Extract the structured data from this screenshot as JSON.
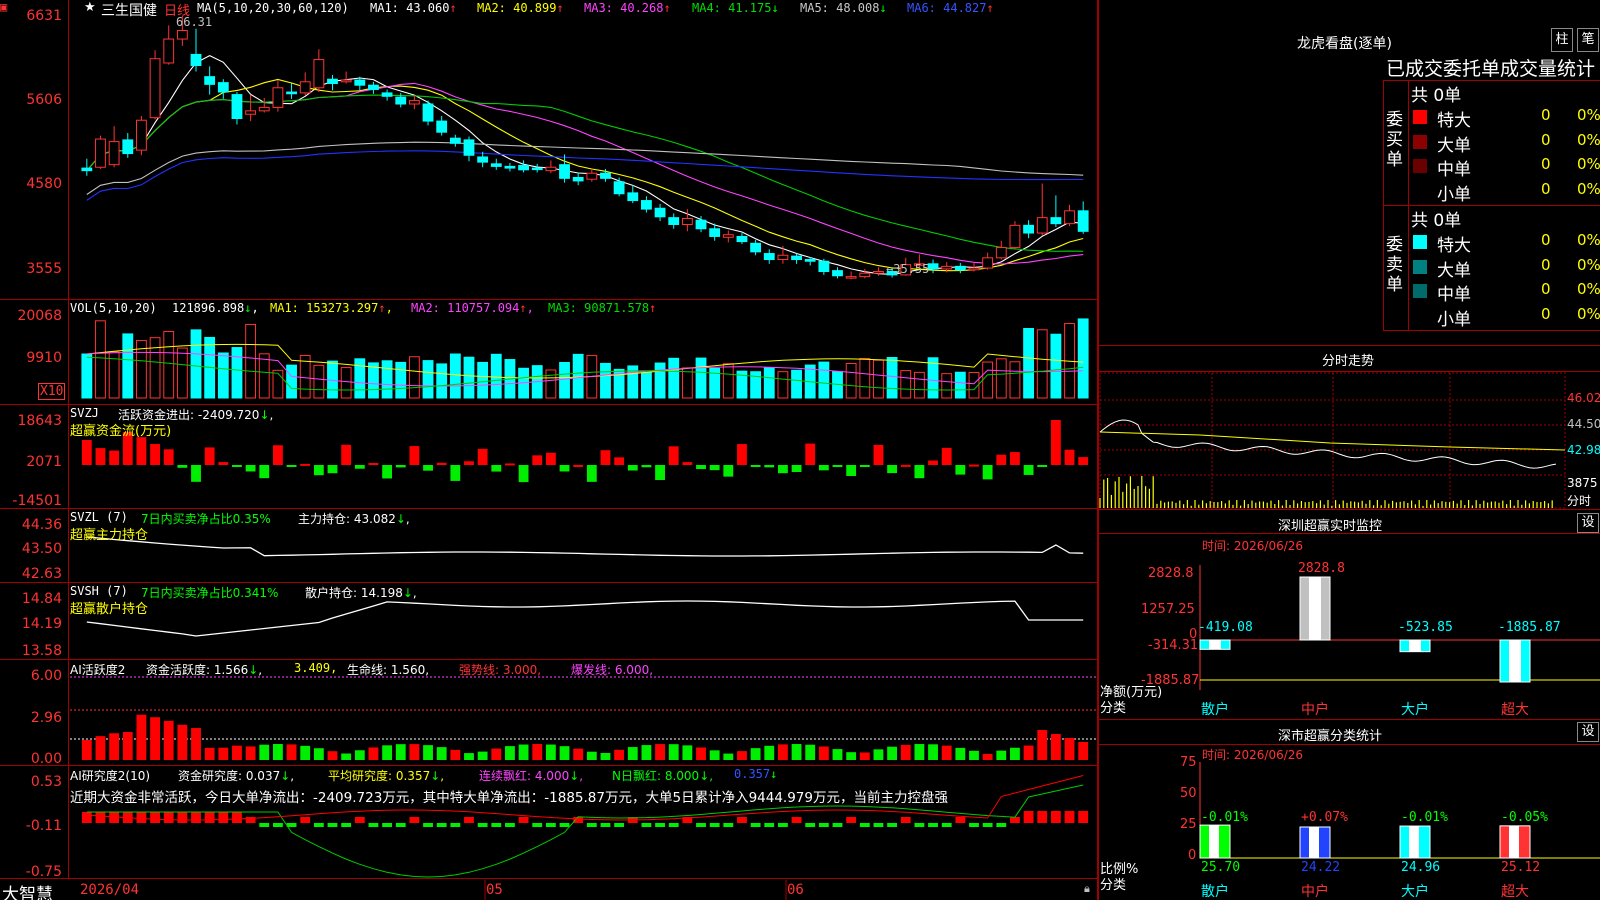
{
  "header": {
    "stock_name": "三生国健",
    "period": "日线",
    "ma_text": "MA(5,10,20,30,60,120)",
    "ma1": "MA1: 43.060",
    "ma2": "MA2: 40.899",
    "ma3": "MA3: 40.268",
    "ma4": "MA4: 41.175",
    "ma5": "MA5: 48.008",
    "ma6": "MA6: 44.827",
    "high_mark": "66.31",
    "low_mark": "35.55"
  },
  "price_axis": [
    "6631",
    "5606",
    "4580",
    "3555"
  ],
  "vol": {
    "title": "VOL(5,10,20)",
    "value": "121896.898",
    "ma1": "MA1: 153273.297",
    "ma2": "MA2: 110757.094",
    "ma3": "MA3: 90871.578",
    "axis": [
      "20068",
      "9910"
    ],
    "unit": "X10"
  },
  "svzj": {
    "title": "SVZJ",
    "desc": "活跃资金进出: -2409.720",
    "sub": "超赢资金流(万元)",
    "axis": [
      "18643",
      "2071",
      "-14501"
    ]
  },
  "svzl": {
    "title": "SVZL (7)",
    "desc": "7日内买卖净占比0.35%",
    "hold": "主力持仓: 43.082",
    "sub": "超赢主力持仓",
    "axis": [
      "44.36",
      "43.50",
      "42.63"
    ]
  },
  "svsh": {
    "title": "SVSH (7)",
    "desc": "7日内买卖净占比0.341%",
    "hold": "散户持仓: 14.198",
    "sub": "超赢散户持仓",
    "axis": [
      "14.84",
      "14.19",
      "13.58"
    ]
  },
  "ai1": {
    "title": "AI活跃度2",
    "a": "资金活跃度: 1.566",
    "b": "3.409,",
    "c": "生命线: 1.560,",
    "d": "强势线: 3.000,",
    "e": "爆发线: 6.000,",
    "axis": [
      "6.00",
      "2.96",
      "0.00"
    ]
  },
  "ai2": {
    "title": "AI研究度2(10)",
    "a": "资金研究度: 0.037",
    "b": "平均研究度: 0.357",
    "c": "连续飘红: 4.000",
    "d": "N日飘红: 8.000",
    "e": "0.357",
    "note": "近期大资金非常活跃，今日大单净流出：-2409.723万元，其中特大单净流出：-1885.87万元，大单5日累计净入9444.979万元，当前主力控盘强",
    "axis": [
      "0.53",
      "-0.11",
      "-0.75"
    ]
  },
  "bottom": {
    "brand": "大智慧",
    "d1": "2026/04",
    "d2": "05",
    "d3": "06"
  },
  "right": {
    "lh_title": "龙虎看盘(逐单)",
    "btn1": "柱",
    "btn2": "笔",
    "stat_title": "已成交委托单成交量统计",
    "buy_label": "委买单",
    "sell_label": "委卖单",
    "buy_total": "共 0单",
    "sell_total": "共 0单",
    "buy_rows": [
      {
        "name": "特大",
        "val": "0",
        "pct": "0%",
        "color": "#ff0000"
      },
      {
        "name": "大单",
        "val": "0",
        "pct": "0%",
        "color": "#8b0000"
      },
      {
        "name": "中单",
        "val": "0",
        "pct": "0%",
        "color": "#6b0000"
      },
      {
        "name": "小单",
        "val": "0",
        "pct": "0%",
        "color": ""
      }
    ],
    "sell_rows": [
      {
        "name": "特大",
        "val": "0",
        "pct": "0%",
        "color": "#00ffff"
      },
      {
        "name": "大单",
        "val": "0",
        "pct": "0%",
        "color": "#008080"
      },
      {
        "name": "中单",
        "val": "0",
        "pct": "0%",
        "color": "#006b6b"
      },
      {
        "name": "小单",
        "val": "0",
        "pct": "0%",
        "color": ""
      }
    ],
    "ts_title": "分时走势",
    "ts_axis": [
      "46.02",
      "44.50",
      "42.98",
      "3875"
    ],
    "ts_foot": "分时",
    "sz_title": "深圳超赢实时监控",
    "sz_btn": "设",
    "sz_time": "时间: 2026/06/26",
    "sz_axis": [
      "2828.8",
      "1257.25",
      "0",
      "-314.31",
      "-1885.87"
    ],
    "sz_vals": [
      "-419.08",
      "2828.8",
      "-523.85",
      "-1885.87"
    ],
    "sz_ylab": "净额(万元)",
    "sz_xlab": "分类",
    "cats": [
      "散户",
      "中户",
      "大户",
      "超大"
    ],
    "cls_title": "深市超赢分类统计",
    "cls_btn": "设",
    "cls_time": "时间: 2026/06/26",
    "cls_axis": [
      "75",
      "50",
      "25",
      "0"
    ],
    "cls_pct": [
      "-0.01%",
      "+0.07%",
      "-0.01%",
      "-0.05%"
    ],
    "cls_vals": [
      "25.70",
      "24.22",
      "24.96",
      "25.12"
    ],
    "cls_ylab": "比例%",
    "cls_xlab": "分类"
  },
  "chart_data": {
    "type": "bar",
    "title": "深圳超赢实时监控",
    "categories": [
      "散户",
      "中户",
      "大户",
      "超大"
    ],
    "values": [
      -419.08,
      2828.8,
      -523.85,
      -1885.87
    ],
    "ylabel": "净额(万元)",
    "ylim": [
      -1885.87,
      2828.8
    ],
    "candles": [
      [
        48.5,
        48.2,
        49.6,
        47.6
      ],
      [
        48.6,
        51.9,
        52.3,
        48.4
      ],
      [
        48.9,
        51.6,
        53.4,
        48.6
      ],
      [
        51.8,
        50.2,
        52.6,
        49.7
      ],
      [
        50.6,
        54.1,
        54.6,
        50.0
      ],
      [
        54.4,
        61.3,
        62.3,
        54.2
      ],
      [
        60.8,
        63.6,
        65.2,
        60.6
      ],
      [
        63.6,
        64.6,
        66.3,
        62.8
      ],
      [
        61.8,
        60.5,
        64.8,
        59.8
      ],
      [
        59.2,
        58.3,
        60.4,
        57.1
      ],
      [
        58.5,
        57.4,
        58.9,
        56.6
      ],
      [
        57.1,
        54.3,
        57.4,
        53.6
      ],
      [
        54.8,
        55.2,
        57.1,
        54.0
      ],
      [
        55.2,
        55.6,
        56.7,
        55.0
      ],
      [
        55.6,
        57.9,
        58.8,
        55.1
      ],
      [
        57.4,
        57.2,
        58.4,
        56.6
      ],
      [
        57.3,
        58.6,
        59.7,
        57.0
      ],
      [
        57.9,
        61.2,
        62.4,
        57.4
      ],
      [
        58.9,
        58.4,
        59.4,
        57.6
      ],
      [
        58.6,
        58.8,
        59.8,
        58.4
      ],
      [
        58.8,
        58.2,
        59.2,
        57.6
      ],
      [
        58.2,
        57.7,
        58.6,
        57.2
      ],
      [
        57.3,
        56.9,
        57.7,
        56.4
      ],
      [
        56.8,
        56.0,
        57.3,
        55.6
      ],
      [
        56.0,
        56.4,
        57.0,
        55.4
      ],
      [
        56.0,
        54.0,
        56.4,
        53.5
      ],
      [
        54.0,
        52.7,
        54.6,
        52.3
      ],
      [
        52.0,
        51.4,
        52.4,
        51.0
      ],
      [
        51.8,
        50.0,
        52.2,
        49.3
      ],
      [
        49.8,
        49.2,
        50.4,
        48.6
      ],
      [
        49.0,
        48.7,
        49.6,
        48.3
      ],
      [
        48.7,
        48.5,
        49.1,
        48.1
      ],
      [
        48.8,
        48.3,
        49.4,
        48.0
      ],
      [
        48.5,
        48.4,
        49.0,
        48.0
      ],
      [
        48.2,
        48.6,
        49.4,
        47.9
      ],
      [
        48.9,
        47.3,
        50.1,
        46.8
      ],
      [
        47.4,
        47.0,
        48.0,
        46.5
      ],
      [
        47.2,
        47.9,
        48.4,
        46.9
      ],
      [
        47.9,
        47.3,
        48.4,
        46.9
      ],
      [
        46.9,
        45.5,
        47.4,
        45.2
      ],
      [
        45.6,
        44.7,
        46.5,
        44.4
      ],
      [
        44.7,
        43.7,
        45.2,
        43.3
      ],
      [
        43.8,
        42.8,
        44.3,
        42.3
      ],
      [
        42.7,
        41.9,
        43.2,
        41.4
      ],
      [
        41.9,
        42.6,
        43.7,
        41.1
      ],
      [
        42.4,
        41.4,
        42.9,
        41.0
      ],
      [
        41.4,
        40.5,
        42.0,
        40.0
      ],
      [
        40.4,
        40.7,
        41.2,
        39.8
      ],
      [
        40.5,
        39.9,
        40.9,
        39.6
      ],
      [
        39.7,
        38.7,
        40.1,
        38.3
      ],
      [
        38.5,
        37.8,
        39.0,
        37.3
      ],
      [
        37.8,
        38.3,
        39.4,
        37.3
      ],
      [
        38.2,
        37.8,
        38.5,
        37.3
      ],
      [
        37.8,
        37.6,
        38.1,
        37.1
      ],
      [
        37.6,
        36.4,
        37.9,
        36.0
      ],
      [
        36.5,
        35.9,
        36.9,
        35.6
      ],
      [
        35.7,
        35.8,
        36.4,
        35.5
      ],
      [
        35.8,
        36.2,
        36.7,
        35.6
      ],
      [
        36.2,
        36.4,
        36.9,
        35.9
      ],
      [
        36.4,
        36.0,
        36.8,
        35.7
      ],
      [
        36.0,
        37.2,
        38.0,
        35.9
      ],
      [
        37.2,
        37.3,
        38.4,
        36.9
      ],
      [
        37.3,
        36.7,
        37.8,
        36.2
      ],
      [
        36.7,
        37.0,
        37.5,
        36.3
      ],
      [
        37.0,
        36.6,
        37.4,
        36.2
      ],
      [
        36.6,
        36.8,
        37.4,
        36.4
      ],
      [
        36.8,
        38.0,
        38.6,
        36.6
      ],
      [
        38.0,
        39.2,
        40.0,
        37.8
      ],
      [
        39.2,
        41.8,
        42.3,
        39.0
      ],
      [
        41.8,
        40.9,
        42.4,
        40.3
      ],
      [
        40.9,
        42.7,
        46.7,
        40.6
      ],
      [
        42.7,
        42.0,
        45.3,
        41.6
      ],
      [
        42.0,
        43.5,
        44.2,
        41.7
      ],
      [
        43.5,
        41.1,
        44.6,
        40.8
      ]
    ]
  }
}
